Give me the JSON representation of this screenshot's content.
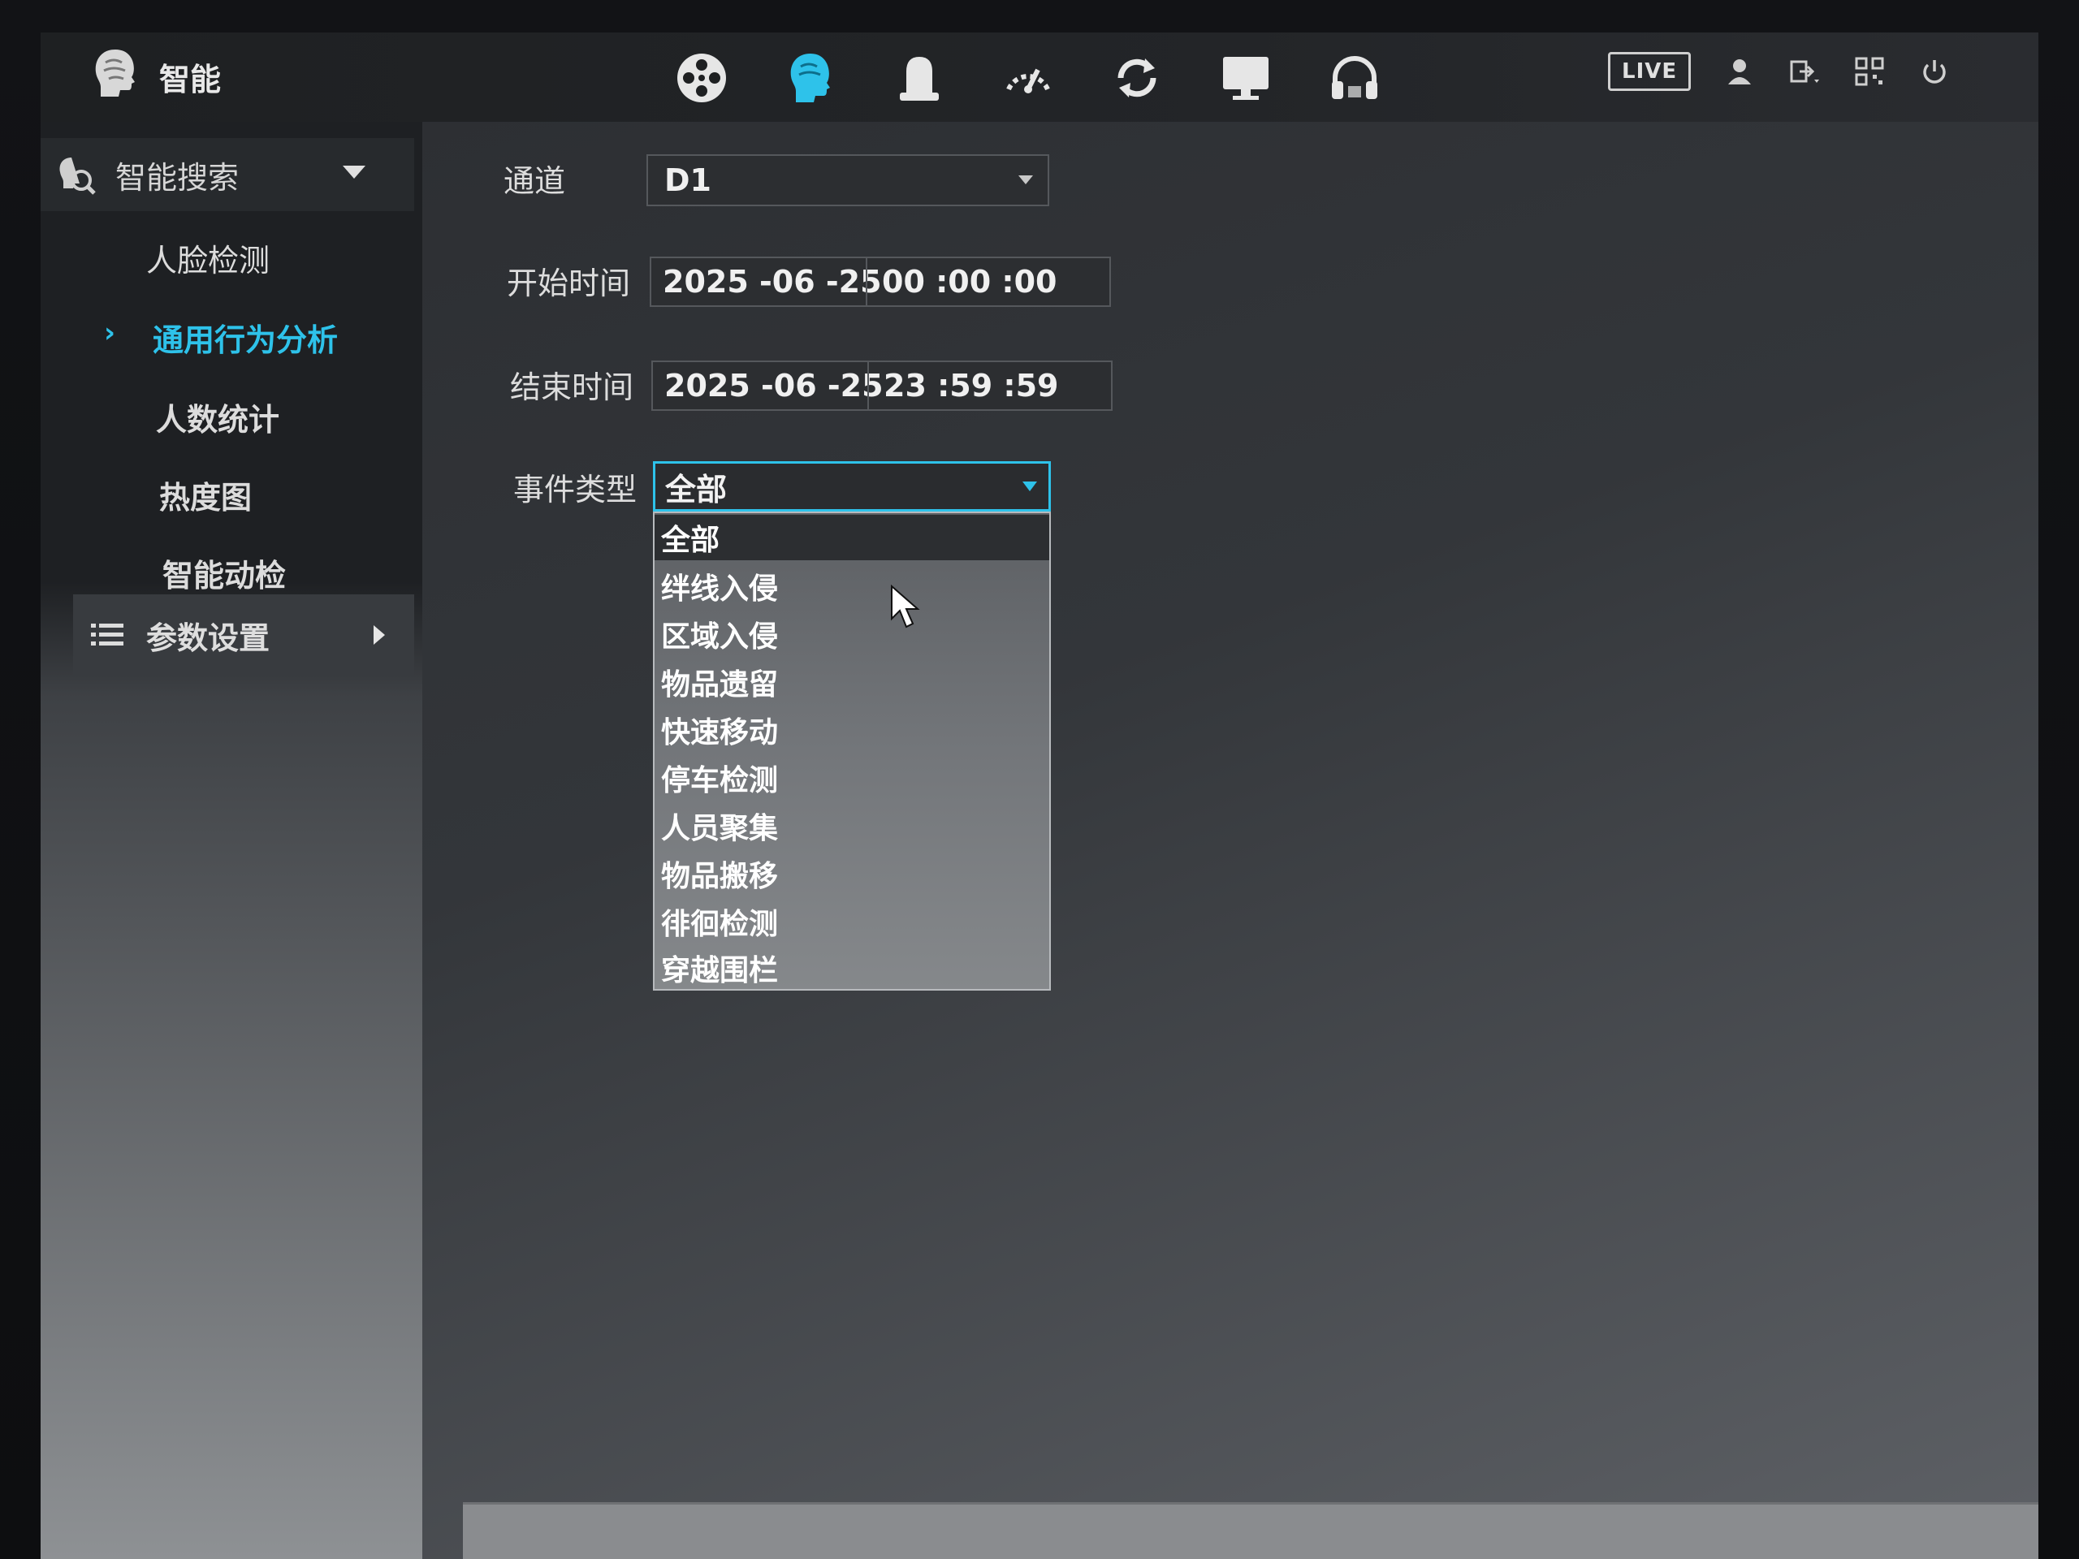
{
  "header": {
    "title": "智能",
    "live_label": "LIVE",
    "nav_icons": [
      "film-reel-icon",
      "brain-head-icon",
      "alarm-light-icon",
      "gauge-icon",
      "refresh-icon",
      "monitor-icon",
      "headset-icon"
    ],
    "tool_icons": [
      "user-icon",
      "logout-icon",
      "qr-code-icon",
      "power-icon"
    ],
    "accent_color": "#2ec2ea"
  },
  "sidebar": {
    "section_title": "智能搜索",
    "items": [
      {
        "label": "人脸检测",
        "active": false
      },
      {
        "label": "通用行为分析",
        "active": true
      },
      {
        "label": "人数统计",
        "active": false
      },
      {
        "label": "热度图",
        "active": false
      },
      {
        "label": "智能动检",
        "active": false
      }
    ],
    "params_label": "参数设置"
  },
  "form": {
    "channel_label": "通道",
    "channel_value": "D1",
    "start_label": "开始时间",
    "start_date": "2025 -06 -25",
    "start_time": "00 :00 :00",
    "end_label": "结束时间",
    "end_date": "2025 -06 -25",
    "end_time": "23 :59 :59",
    "event_label": "事件类型",
    "event_value": "全部"
  },
  "dropdown": {
    "options": [
      "全部",
      "绊线入侵",
      "区域入侵",
      "物品遗留",
      "快速移动",
      "停车检测",
      "人员聚集",
      "物品搬移",
      "徘徊检测",
      "穿越围栏"
    ],
    "selected": "全部"
  }
}
